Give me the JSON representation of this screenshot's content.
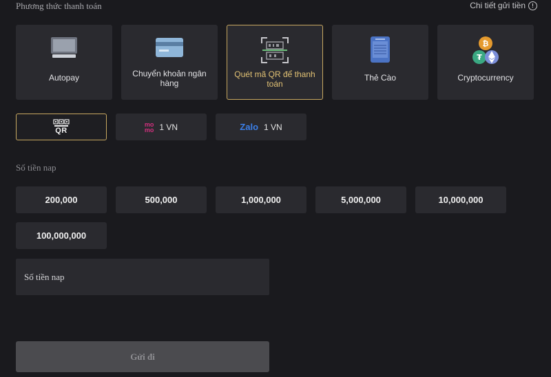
{
  "header": {
    "section_title": "Phương thức thanh toán",
    "details_link": "Chi tiết gửi tiền",
    "info_icon": "info-icon"
  },
  "methods": [
    {
      "label": "Autopay",
      "icon": "monitor-icon"
    },
    {
      "label": "Chuyển khoản ngân hàng",
      "icon": "bank-card-icon"
    },
    {
      "label": "Quét mã QR để thanh toán",
      "icon": "qr-scan-icon",
      "active": true
    },
    {
      "label": "Thẻ Cào",
      "icon": "phone-card-icon"
    },
    {
      "label": "Cryptocurrency",
      "icon": "crypto-coins-icon"
    }
  ],
  "sub_options": [
    {
      "label": "QR",
      "icon": "qr-code-icon",
      "active": true
    },
    {
      "brand": "mo mo",
      "label": "1 VN",
      "icon": "momo-icon"
    },
    {
      "brand": "Zalo",
      "label": "1 VN",
      "icon": "zalo-icon"
    }
  ],
  "amount": {
    "label": "Số tiền nap",
    "presets": [
      "200,000",
      "500,000",
      "1,000,000",
      "5,000,000",
      "10,000,000",
      "100,000,000"
    ],
    "input_placeholder": "Số tiền nap"
  },
  "submit_label": "Gửi đi",
  "colors": {
    "background": "#1a1a1e",
    "card": "#2a2a2f",
    "accent": "#c9a961",
    "button_disabled": "#4b4b4f"
  }
}
